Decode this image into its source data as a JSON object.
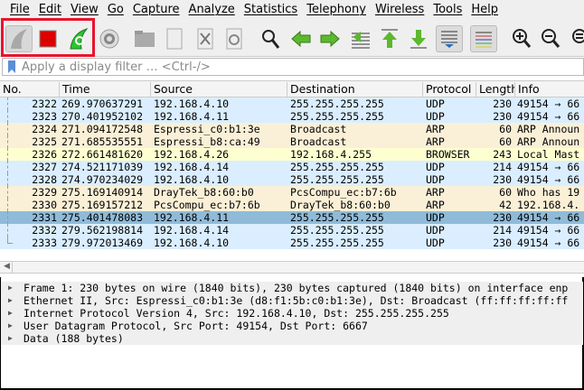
{
  "menu": [
    "File",
    "Edit",
    "View",
    "Go",
    "Capture",
    "Analyze",
    "Statistics",
    "Telephony",
    "Wireless",
    "Tools",
    "Help"
  ],
  "filter": {
    "placeholder": "Apply a display filter … <Ctrl-/>"
  },
  "columns": [
    "No.",
    "Time",
    "Source",
    "Destination",
    "Protocol",
    "Length",
    "Info"
  ],
  "colors": {
    "udp": "#daeeff",
    "arp": "#faf0d7",
    "browser": "#feffd0",
    "selected": "#8fbbd9",
    "highlight": "#e8142e"
  },
  "packets": [
    {
      "no": "2322",
      "time": "269.970637291",
      "src": "192.168.4.10",
      "dst": "255.255.255.255",
      "proto": "UDP",
      "len": "230",
      "info": "49154 → 66",
      "type": "udp"
    },
    {
      "no": "2323",
      "time": "270.401952102",
      "src": "192.168.4.11",
      "dst": "255.255.255.255",
      "proto": "UDP",
      "len": "230",
      "info": "49154 → 66",
      "type": "udp"
    },
    {
      "no": "2324",
      "time": "271.094172548",
      "src": "Espressi_c0:b1:3e",
      "dst": "Broadcast",
      "proto": "ARP",
      "len": "60",
      "info": "ARP Announ",
      "type": "arp"
    },
    {
      "no": "2325",
      "time": "271.685535551",
      "src": "Espressi_b8:ca:49",
      "dst": "Broadcast",
      "proto": "ARP",
      "len": "60",
      "info": "ARP Announ",
      "type": "arp"
    },
    {
      "no": "2326",
      "time": "272.661481620",
      "src": "192.168.4.26",
      "dst": "192.168.4.255",
      "proto": "BROWSER",
      "len": "243",
      "info": "Local Mast",
      "type": "browser"
    },
    {
      "no": "2327",
      "time": "274.521171039",
      "src": "192.168.4.14",
      "dst": "255.255.255.255",
      "proto": "UDP",
      "len": "214",
      "info": "49154 → 66",
      "type": "udp"
    },
    {
      "no": "2328",
      "time": "274.970234029",
      "src": "192.168.4.10",
      "dst": "255.255.255.255",
      "proto": "UDP",
      "len": "230",
      "info": "49154 → 66",
      "type": "udp"
    },
    {
      "no": "2329",
      "time": "275.169140914",
      "src": "DrayTek_b8:60:b0",
      "dst": "PcsCompu_ec:b7:6b",
      "proto": "ARP",
      "len": "60",
      "info": "Who has 19",
      "type": "arp"
    },
    {
      "no": "2330",
      "time": "275.169157212",
      "src": "PcsCompu_ec:b7:6b",
      "dst": "DrayTek_b8:60:b0",
      "proto": "ARP",
      "len": "42",
      "info": "192.168.4.",
      "type": "arp"
    },
    {
      "no": "2331",
      "time": "275.401478083",
      "src": "192.168.4.11",
      "dst": "255.255.255.255",
      "proto": "UDP",
      "len": "230",
      "info": "49154 → 66",
      "type": "selected"
    },
    {
      "no": "2332",
      "time": "279.562198814",
      "src": "192.168.4.14",
      "dst": "255.255.255.255",
      "proto": "UDP",
      "len": "214",
      "info": "49154 → 66",
      "type": "udp"
    },
    {
      "no": "2333",
      "time": "279.972013469",
      "src": "192.168.4.10",
      "dst": "255.255.255.255",
      "proto": "UDP",
      "len": "230",
      "info": "49154 → 66",
      "type": "udp"
    }
  ],
  "details": [
    "Frame 1: 230 bytes on wire (1840 bits), 230 bytes captured (1840 bits) on interface enp",
    "Ethernet II, Src: Espressi_c0:b1:3e (d8:f1:5b:c0:b1:3e), Dst: Broadcast (ff:ff:ff:ff:ff",
    "Internet Protocol Version 4, Src: 192.168.4.10, Dst: 255.255.255.255",
    "User Datagram Protocol, Src Port: 49154, Dst Port: 6667",
    "Data (188 bytes)"
  ]
}
